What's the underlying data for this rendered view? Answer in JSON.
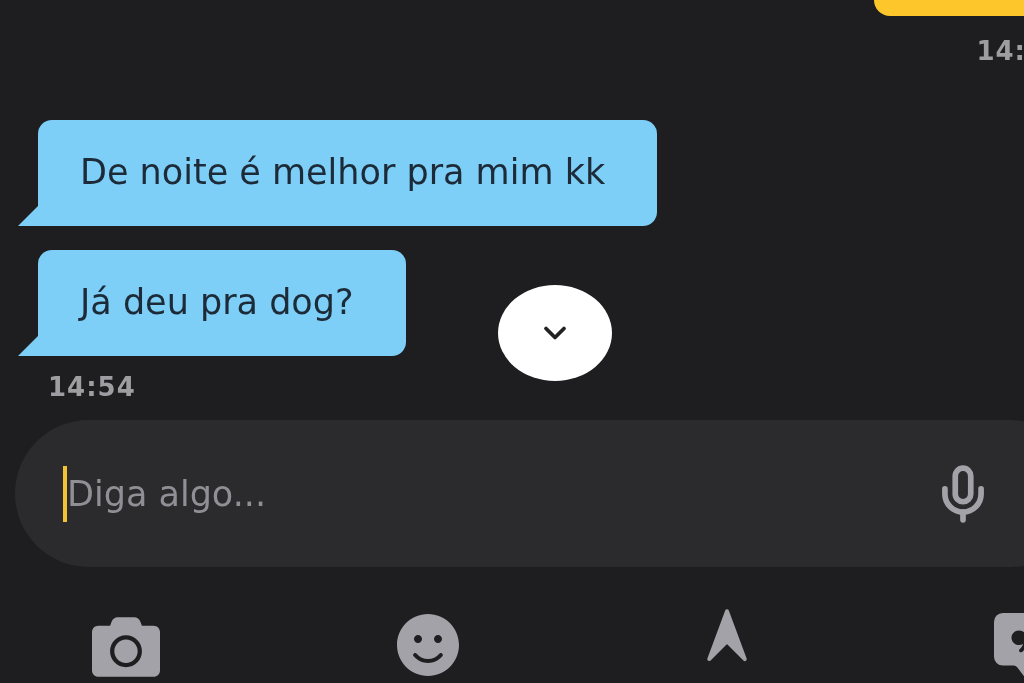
{
  "messages": [
    {
      "kind": "sent"
    },
    {
      "kind": "sent_time",
      "text": "14:"
    },
    {
      "kind": "received",
      "text": "De noite é melhor pra mim kk"
    },
    {
      "kind": "received",
      "text": "Já deu pra dog?"
    },
    {
      "kind": "received_time",
      "text": "14:54"
    }
  ],
  "composer": {
    "placeholder": "Diga algo..."
  }
}
